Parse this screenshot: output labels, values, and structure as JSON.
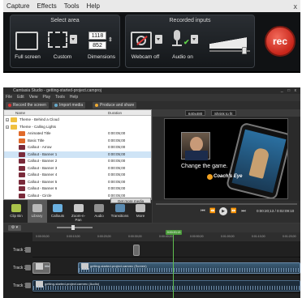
{
  "recorder": {
    "menu": [
      "Capture",
      "Effects",
      "Tools",
      "Help"
    ],
    "close": "x",
    "select_area": {
      "title": "Select area",
      "full_screen": "Full screen",
      "custom": "Custom",
      "width": "1118",
      "height": "852",
      "dimensions": "Dimensions"
    },
    "recorded_inputs": {
      "title": "Recorded inputs",
      "webcam": "Webcam off",
      "audio": "Audio on"
    },
    "audio_level": 0.9,
    "rec_label": "rec"
  },
  "editor": {
    "title": "Camtasia Studio - getting-started-project.camproj",
    "window_controls": "_ □ x",
    "menu": [
      "File",
      "Edit",
      "View",
      "Play",
      "Tools",
      "Help"
    ],
    "toolbar": {
      "record": "Record the screen",
      "import": "Import media",
      "produce": "Produce and share"
    },
    "clip_bin": {
      "col_name": "Name",
      "col_duration": "Duration",
      "rows": [
        {
          "kind": "folder",
          "name": "Theme - Behind a Cloud",
          "dur": ""
        },
        {
          "kind": "folder",
          "name": "Theme - Calling Lights",
          "dur": ""
        },
        {
          "kind": "asset",
          "name": "Animated Title",
          "dur": "0:00:05;00",
          "color": "#e06a2a"
        },
        {
          "kind": "asset",
          "name": "Basic Title",
          "dur": "0:00:05;00",
          "color": "#e06a2a"
        },
        {
          "kind": "asset",
          "name": "Callout - Arrow",
          "dur": "0:00:05;00",
          "color": "#7a2a3a"
        },
        {
          "kind": "asset",
          "name": "Callout - Banner 1",
          "dur": "0:00:05;00",
          "color": "#7a2a3a"
        },
        {
          "kind": "asset",
          "name": "Callout - Banner 2",
          "dur": "0:00:05;00",
          "color": "#7a2a3a"
        },
        {
          "kind": "asset",
          "name": "Callout - Banner 3",
          "dur": "0:00:05;00",
          "color": "#7a2a3a"
        },
        {
          "kind": "asset",
          "name": "Callout - Banner 4",
          "dur": "0:00:05;00",
          "color": "#7a2a3a"
        },
        {
          "kind": "asset",
          "name": "Callout - Banner 5",
          "dur": "0:00:05;00",
          "color": "#7a2a3a"
        },
        {
          "kind": "asset",
          "name": "Callout - Banner 6",
          "dur": "0:00:05;00",
          "color": "#7a2a3a"
        },
        {
          "kind": "asset",
          "name": "Callout - Circle",
          "dur": "0:00:05;00",
          "color": "#7a2a3a"
        }
      ],
      "selected_index": 5,
      "get_more": "Get more media"
    },
    "tabs": [
      "Clip Bin",
      "Library",
      "Callouts",
      "Zoom-n-Pan",
      "Audio",
      "Transitions",
      "More"
    ],
    "preview": {
      "dims": "640x480",
      "shrink": "Shrink to fit",
      "caption": "Change the game.",
      "logo": "Coach's Eye",
      "time": "0:00:20;13 / 0:02:09:10"
    },
    "timeline": {
      "ruler": [
        "0:00:00;00",
        "0:00:10;00",
        "0:00:20;00",
        "0:00:30;00",
        "0:00:40;00",
        "0:00:50;00",
        "0:01:00;00",
        "0:01:10;00",
        "0:01:20;00"
      ],
      "playhead": "0:00:20;13",
      "tracks": [
        {
          "label": "Track 3",
          "clips": [
            {
              "text": "",
              "type": "small"
            }
          ]
        },
        {
          "label": "Track 2",
          "clips": [
            {
              "text": "title-slide",
              "type": "small"
            },
            {
              "text": "getting-started-project.camrec (Screen)",
              "type": "video"
            }
          ]
        },
        {
          "label": "Track 1",
          "clips": [
            {
              "text": "getting-started-project.camrec (Audio)",
              "type": "audio"
            }
          ]
        }
      ]
    }
  }
}
